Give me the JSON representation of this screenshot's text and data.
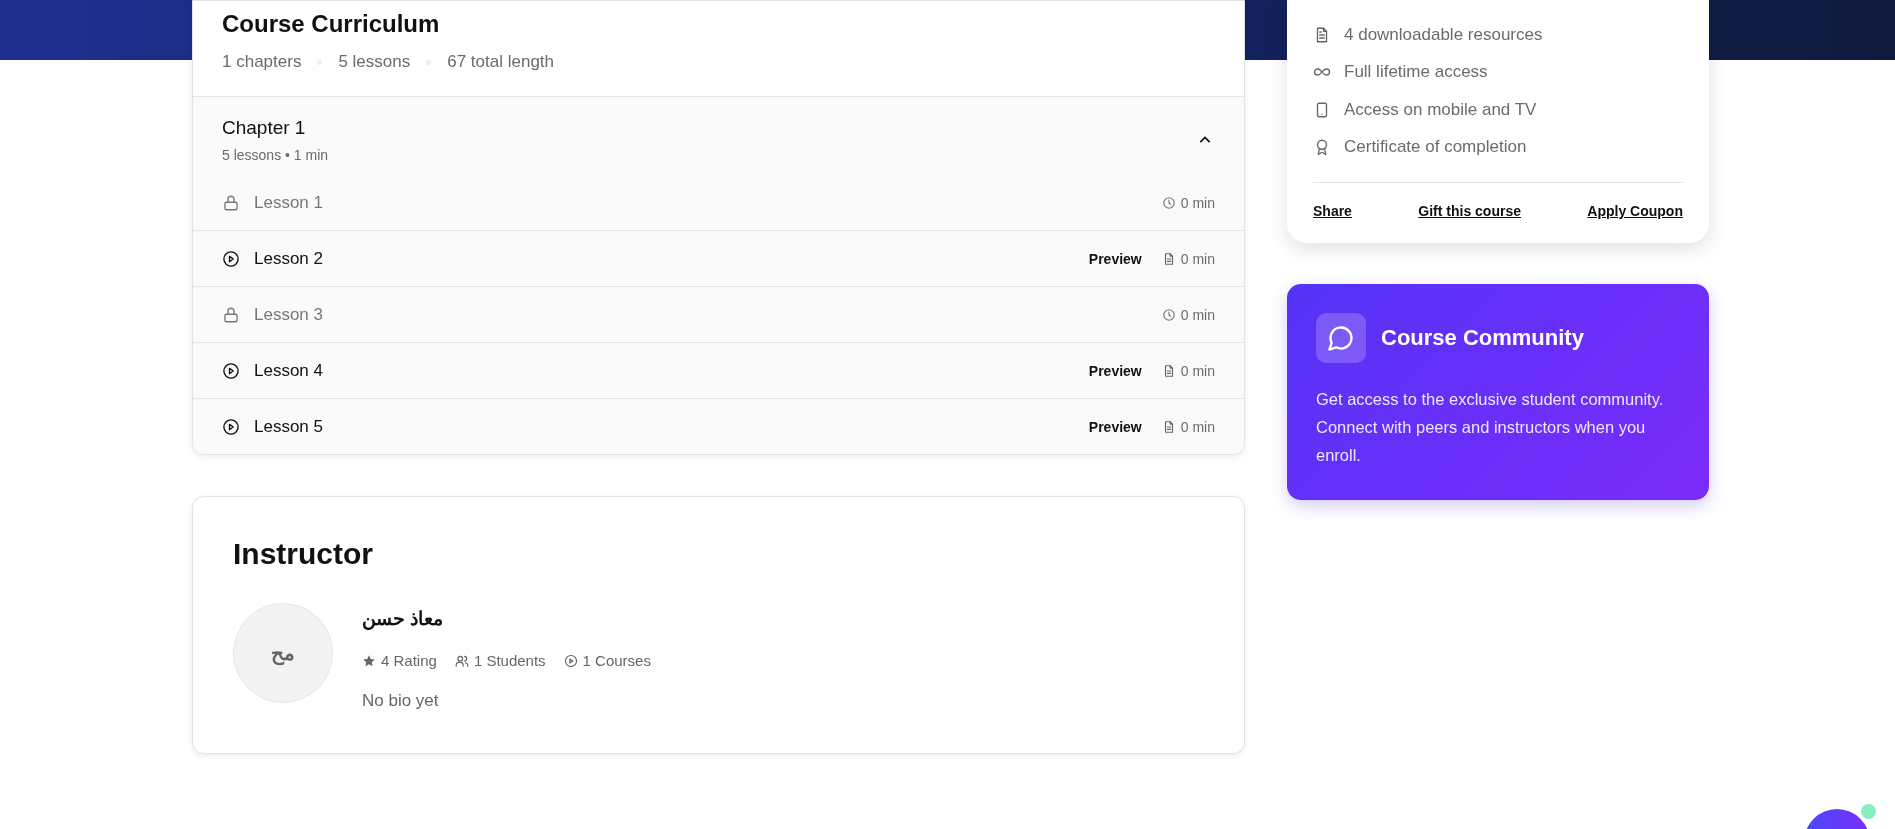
{
  "curriculum": {
    "title": "Course Curriculum",
    "stats": [
      "1 chapters",
      "5 lessons",
      "67 total length"
    ],
    "chapters": [
      {
        "title": "Chapter 1",
        "meta": "5 lessons • 1 min",
        "expanded": true,
        "lessons": [
          {
            "title": "Lesson 1",
            "kind": "locked",
            "duration": "0 min"
          },
          {
            "title": "Lesson 2",
            "kind": "preview",
            "preview": "Preview",
            "duration": "0 min"
          },
          {
            "title": "Lesson 3",
            "kind": "locked",
            "duration": "0 min"
          },
          {
            "title": "Lesson 4",
            "kind": "preview",
            "preview": "Preview",
            "duration": "0 min"
          },
          {
            "title": "Lesson 5",
            "kind": "preview",
            "preview": "Preview",
            "duration": "0 min"
          }
        ]
      }
    ]
  },
  "includes": {
    "items": [
      {
        "kind": "document",
        "text": "4 downloadable resources"
      },
      {
        "kind": "infinity",
        "text": "Full lifetime access"
      },
      {
        "kind": "mobile",
        "text": "Access on mobile and TV"
      },
      {
        "kind": "certificate",
        "text": "Certificate of completion"
      }
    ],
    "links": [
      "Share",
      "Gift this course",
      "Apply Coupon"
    ]
  },
  "community": {
    "title": "Course Community",
    "text": "Get access to the exclusive student community. Connect with peers and instructors when you enroll."
  },
  "instructor": {
    "heading": "Instructor",
    "initials": "مح",
    "name": "معاذ حسن",
    "stats": [
      {
        "kind": "rating",
        "text": "4 Rating"
      },
      {
        "kind": "students",
        "text": "1 Students"
      },
      {
        "kind": "courses",
        "text": "1 Courses"
      }
    ],
    "bio": "No bio yet"
  }
}
